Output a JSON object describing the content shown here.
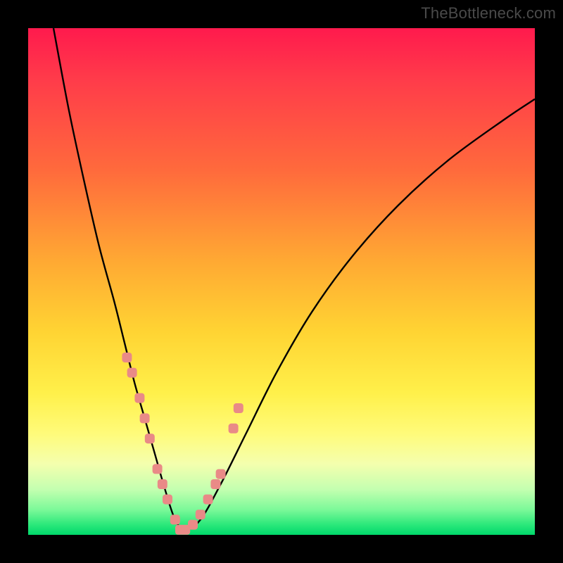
{
  "watermark": "TheBottleneck.com",
  "colors": {
    "frame": "#000000",
    "curve": "#000000",
    "marker": "#e98a87",
    "gradient_top": "#ff1a4d",
    "gradient_bottom": "#00d86b"
  },
  "chart_data": {
    "type": "line",
    "title": "",
    "xlabel": "",
    "ylabel": "",
    "xlim": [
      0,
      100
    ],
    "ylim": [
      0,
      100
    ],
    "grid": false,
    "legend": false,
    "note": "No axis ticks or numeric labels are rendered; values are estimated from pixel positions on a 0–100 normalized scale.",
    "series": [
      {
        "name": "bottleneck-curve",
        "x": [
          5,
          8,
          11,
          14,
          17,
          19,
          21,
          23,
          25,
          27,
          29,
          31,
          34,
          38,
          43,
          49,
          56,
          64,
          73,
          83,
          94,
          100
        ],
        "y": [
          100,
          84,
          70,
          57,
          46,
          38,
          30,
          23,
          16,
          9,
          3,
          1,
          3,
          10,
          20,
          32,
          44,
          55,
          65,
          74,
          82,
          86
        ]
      }
    ],
    "markers": {
      "name": "highlighted-points",
      "color": "#e98a87",
      "x": [
        19.5,
        20.5,
        22.0,
        23.0,
        24.0,
        25.5,
        26.5,
        27.5,
        29.0,
        30.0,
        31.0,
        32.5,
        34.0,
        35.5,
        37.0,
        38.0,
        40.5,
        41.5
      ],
      "y": [
        35,
        32,
        27,
        23,
        19,
        13,
        10,
        7,
        3,
        1,
        1,
        2,
        4,
        7,
        10,
        12,
        21,
        25
      ]
    }
  }
}
